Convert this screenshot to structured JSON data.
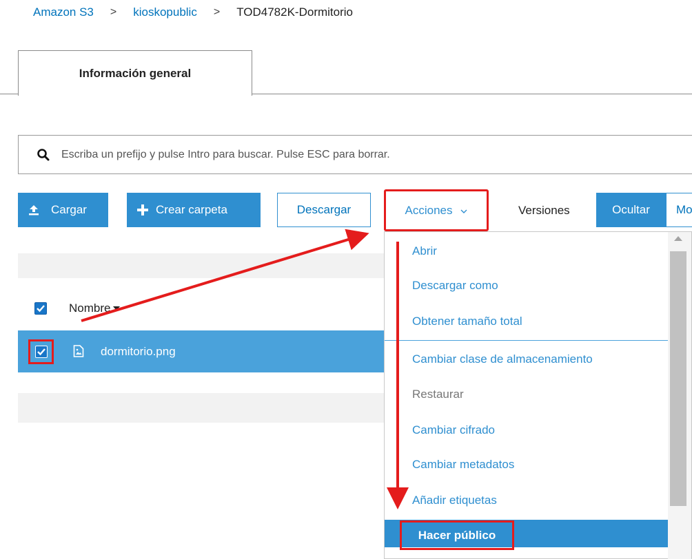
{
  "breadcrumb": {
    "items": [
      "Amazon S3",
      "kioskopublic",
      "TOD4782K-Dormitorio"
    ],
    "separator": ">"
  },
  "tabs": [
    {
      "label": "Información general",
      "active": true
    }
  ],
  "search": {
    "placeholder": "Escriba un prefijo y pulse Intro para buscar. Pulse ESC para borrar.",
    "value": ""
  },
  "toolbar": {
    "upload_label": "Cargar",
    "create_folder_label": "Crear carpeta",
    "download_label": "Descargar",
    "actions_label": "Acciones",
    "versions_label": "Versiones",
    "hide_label": "Ocultar",
    "show_label": "Mo"
  },
  "table": {
    "header": {
      "name_label": "Nombre",
      "sort": "desc",
      "all_checked": true
    },
    "rows": [
      {
        "name": "dormitorio.png",
        "checked": true,
        "icon": "image-file-icon"
      }
    ]
  },
  "actions_menu": {
    "items": [
      {
        "label": "Abrir",
        "enabled": true
      },
      {
        "label": "Descargar como",
        "enabled": true
      },
      {
        "label": "Obtener tamaño total",
        "enabled": true
      },
      {
        "label": "Cambiar clase de almacenamiento",
        "enabled": true
      },
      {
        "label": "Restaurar",
        "enabled": false
      },
      {
        "label": "Cambiar cifrado",
        "enabled": true
      },
      {
        "label": "Cambiar metadatos",
        "enabled": true
      },
      {
        "label": "Añadir etiquetas",
        "enabled": true
      },
      {
        "label": "Hacer público",
        "enabled": true,
        "highlighted": true
      }
    ]
  },
  "colors": {
    "accent": "#2f8fd0",
    "link": "#0073bb",
    "selected_row": "#4aa2db",
    "annotation_red": "#e41c1c"
  }
}
